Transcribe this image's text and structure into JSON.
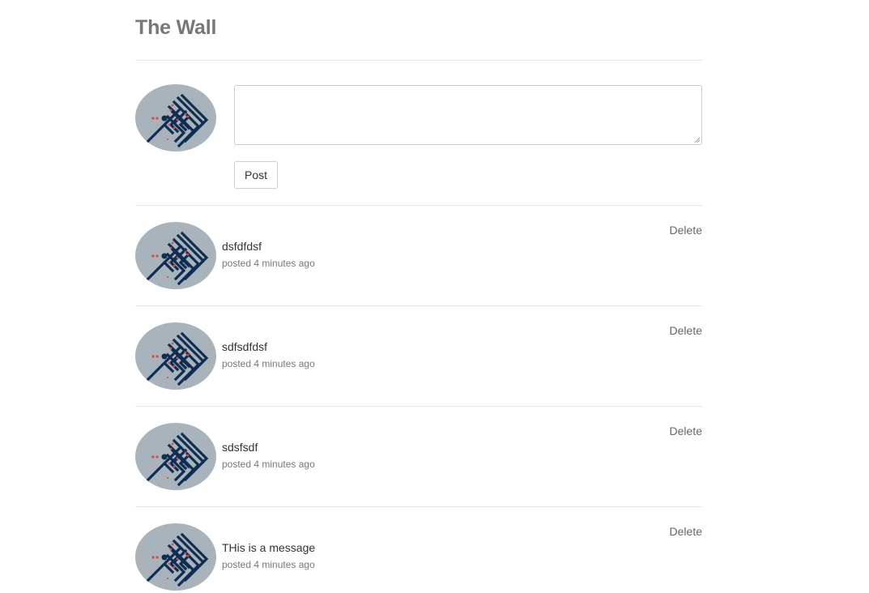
{
  "page": {
    "title": "The Wall"
  },
  "composer": {
    "input_value": "",
    "post_label": "Post"
  },
  "messages": [
    {
      "text": "dsfdfdsf",
      "meta": "posted 4 minutes ago",
      "delete_label": "Delete"
    },
    {
      "text": "sdfsdfdsf",
      "meta": "posted 4 minutes ago",
      "delete_label": "Delete"
    },
    {
      "text": "sdsfsdf",
      "meta": "posted 4 minutes ago",
      "delete_label": "Delete"
    },
    {
      "text": "THis is a message",
      "meta": "posted 4 minutes ago",
      "delete_label": "Delete"
    }
  ],
  "icons": {
    "avatar": "avatar-image"
  },
  "colors": {
    "avatar_background": "#a8b3bb",
    "avatar_glyph": "#0f2d52",
    "avatar_accent": "#d94a4a"
  }
}
